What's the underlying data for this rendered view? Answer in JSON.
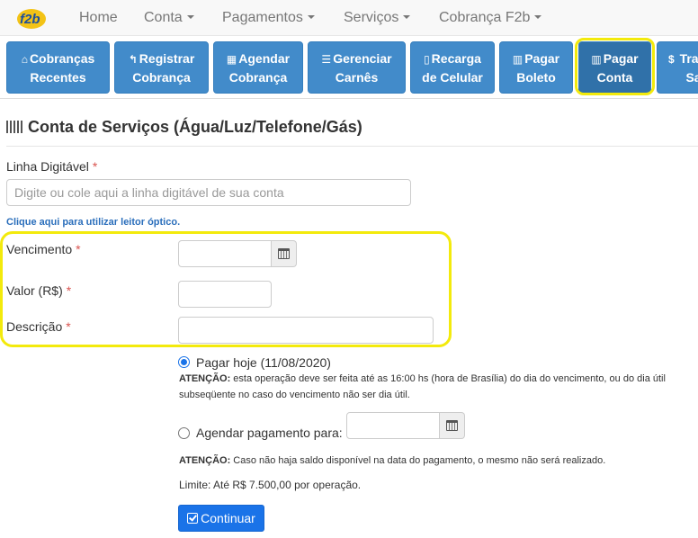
{
  "navbar": {
    "logo_text": "F2b",
    "items": [
      {
        "label": "Home",
        "dropdown": false
      },
      {
        "label": "Conta",
        "dropdown": true
      },
      {
        "label": "Pagamentos",
        "dropdown": true
      },
      {
        "label": "Serviços",
        "dropdown": true
      },
      {
        "label": "Cobrança F2b",
        "dropdown": true
      }
    ]
  },
  "quick_buttons": [
    {
      "line1": "Cobranças",
      "line2": "Recentes",
      "icon": "inbox-icon",
      "glyph": "⌂"
    },
    {
      "line1": "Registrar",
      "line2": "Cobrança",
      "icon": "reply-icon",
      "glyph": "↰"
    },
    {
      "line1": "Agendar",
      "line2": "Cobrança",
      "icon": "calendar-icon",
      "glyph": "▦"
    },
    {
      "line1": "Gerenciar",
      "line2": "Carnês",
      "icon": "list-icon",
      "glyph": "☰"
    },
    {
      "line1": "Recarga",
      "line2": "de Celular",
      "icon": "mobile-icon",
      "glyph": "▯"
    },
    {
      "line1": "Pagar",
      "line2": "Boleto",
      "icon": "barcode-icon",
      "glyph": "▥"
    },
    {
      "line1": "Pagar",
      "line2": "Conta",
      "icon": "barcode-icon",
      "glyph": "▥",
      "active": true
    },
    {
      "line1": "Tra",
      "line2": "Sa",
      "icon": "dollar-icon",
      "glyph": "$"
    }
  ],
  "page": {
    "title": "Conta de Serviços (Água/Luz/Telefone/Gás)"
  },
  "form": {
    "linha_digitavel": {
      "label": "Linha Digitável",
      "required_mark": "*",
      "placeholder": "Digite ou cole aqui a linha digitável de sua conta",
      "value": ""
    },
    "optical_reader_link": "Clique aqui para utilizar leitor óptico.",
    "vencimento": {
      "label": "Vencimento",
      "required_mark": "*",
      "value": ""
    },
    "valor": {
      "label": "Valor (R$)",
      "required_mark": "*",
      "value": ""
    },
    "descricao": {
      "label": "Descrição",
      "required_mark": "*",
      "value": ""
    },
    "pay_today": {
      "label": "Pagar hoje (11/08/2020)",
      "checked": true,
      "warning_bold": "ATENÇÃO:",
      "warning_text": " esta operação deve ser feita até as 16:00 hs (hora de Brasília) do dia do vencimento, ou do dia útil subseqüente no caso do vencimento não ser dia útil."
    },
    "schedule": {
      "label": "Agendar pagamento para:",
      "checked": false,
      "value": "",
      "warning_bold": "ATENÇÃO:",
      "warning_text": " Caso não haja saldo disponível na data do pagamento, o mesmo não será realizado."
    },
    "limit_text": "Limite: Até R$ 7.500,00 por operação.",
    "submit_label": "Continuar"
  },
  "colors": {
    "primary_button": "#428bca",
    "highlight": "#f3ea0c",
    "submit": "#1a73e8",
    "required": "#d9534f",
    "link": "#2a6ebb"
  }
}
